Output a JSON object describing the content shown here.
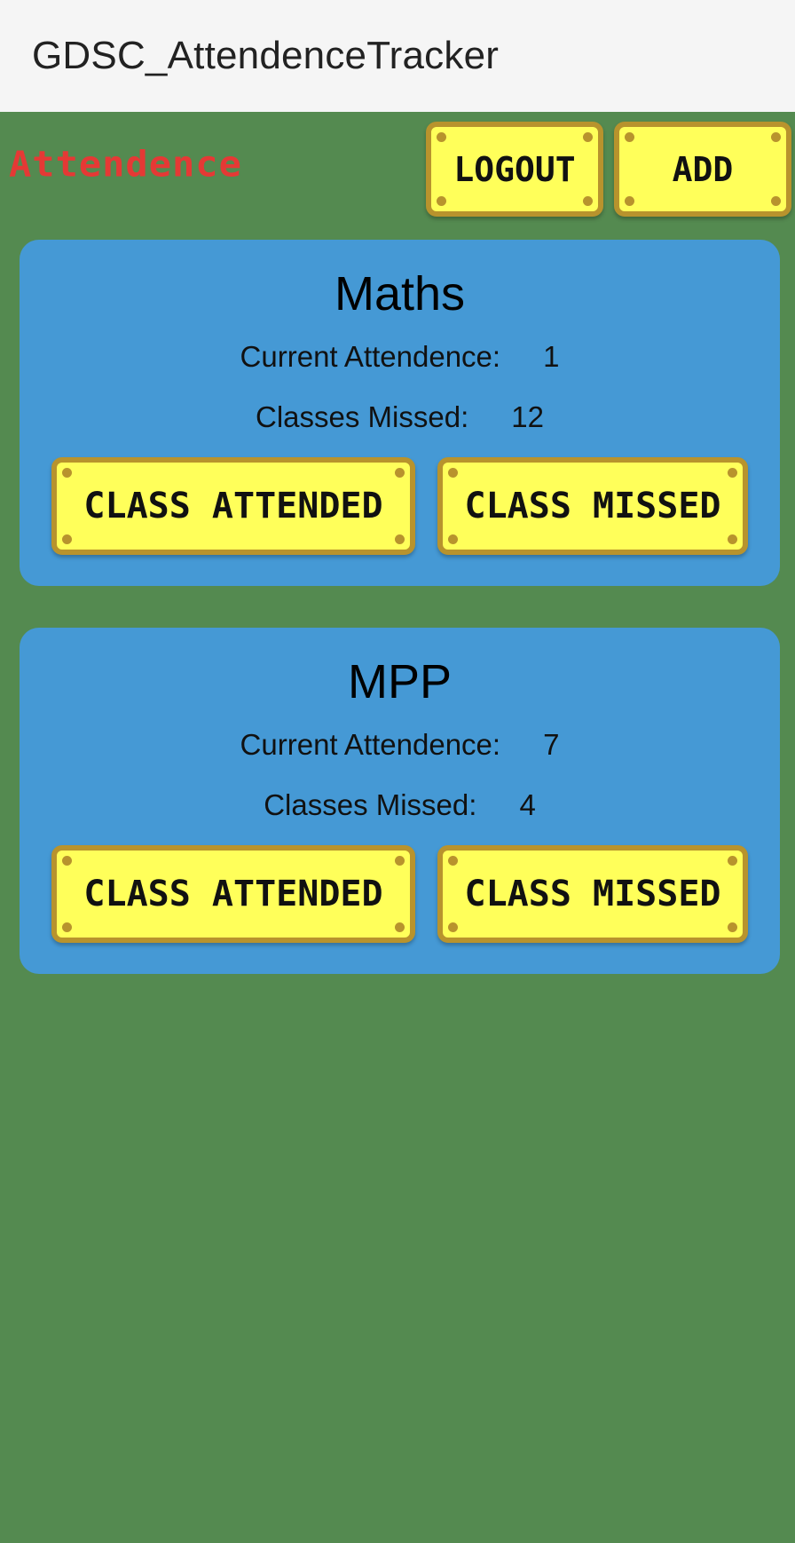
{
  "app_bar": {
    "title": "GDSC_AttendenceTracker"
  },
  "header": {
    "title": "Attendence",
    "logout_label": "LOGOUT",
    "add_label": "ADD"
  },
  "subjects": [
    {
      "name": "Maths",
      "attended_label": "Current Attendence:",
      "attended_value": "1",
      "missed_label": "Classes Missed:",
      "missed_value": "12",
      "attended_button": "CLASS ATTENDED",
      "missed_button": "CLASS MISSED"
    },
    {
      "name": "MPP",
      "attended_label": "Current Attendence:",
      "attended_value": "7",
      "missed_label": "Classes Missed:",
      "missed_value": "4",
      "attended_button": "CLASS ATTENDED",
      "missed_button": "CLASS MISSED"
    }
  ],
  "colors": {
    "background": "#548a50",
    "app_bar": "#f5f5f5",
    "card": "#4599d5",
    "button": "#ffff5a",
    "button_border": "#b8932d",
    "title_red": "#e53935"
  }
}
